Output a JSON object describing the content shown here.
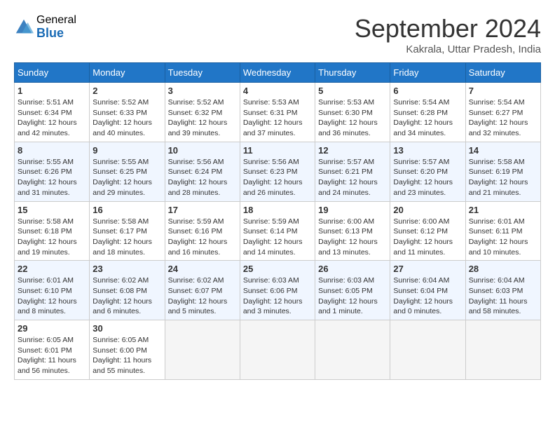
{
  "header": {
    "logo_general": "General",
    "logo_blue": "Blue",
    "month_title": "September 2024",
    "location": "Kakrala, Uttar Pradesh, India"
  },
  "days_of_week": [
    "Sunday",
    "Monday",
    "Tuesday",
    "Wednesday",
    "Thursday",
    "Friday",
    "Saturday"
  ],
  "weeks": [
    [
      {
        "day": "1",
        "info": "Sunrise: 5:51 AM\nSunset: 6:34 PM\nDaylight: 12 hours\nand 42 minutes."
      },
      {
        "day": "2",
        "info": "Sunrise: 5:52 AM\nSunset: 6:33 PM\nDaylight: 12 hours\nand 40 minutes."
      },
      {
        "day": "3",
        "info": "Sunrise: 5:52 AM\nSunset: 6:32 PM\nDaylight: 12 hours\nand 39 minutes."
      },
      {
        "day": "4",
        "info": "Sunrise: 5:53 AM\nSunset: 6:31 PM\nDaylight: 12 hours\nand 37 minutes."
      },
      {
        "day": "5",
        "info": "Sunrise: 5:53 AM\nSunset: 6:30 PM\nDaylight: 12 hours\nand 36 minutes."
      },
      {
        "day": "6",
        "info": "Sunrise: 5:54 AM\nSunset: 6:28 PM\nDaylight: 12 hours\nand 34 minutes."
      },
      {
        "day": "7",
        "info": "Sunrise: 5:54 AM\nSunset: 6:27 PM\nDaylight: 12 hours\nand 32 minutes."
      }
    ],
    [
      {
        "day": "8",
        "info": "Sunrise: 5:55 AM\nSunset: 6:26 PM\nDaylight: 12 hours\nand 31 minutes."
      },
      {
        "day": "9",
        "info": "Sunrise: 5:55 AM\nSunset: 6:25 PM\nDaylight: 12 hours\nand 29 minutes."
      },
      {
        "day": "10",
        "info": "Sunrise: 5:56 AM\nSunset: 6:24 PM\nDaylight: 12 hours\nand 28 minutes."
      },
      {
        "day": "11",
        "info": "Sunrise: 5:56 AM\nSunset: 6:23 PM\nDaylight: 12 hours\nand 26 minutes."
      },
      {
        "day": "12",
        "info": "Sunrise: 5:57 AM\nSunset: 6:21 PM\nDaylight: 12 hours\nand 24 minutes."
      },
      {
        "day": "13",
        "info": "Sunrise: 5:57 AM\nSunset: 6:20 PM\nDaylight: 12 hours\nand 23 minutes."
      },
      {
        "day": "14",
        "info": "Sunrise: 5:58 AM\nSunset: 6:19 PM\nDaylight: 12 hours\nand 21 minutes."
      }
    ],
    [
      {
        "day": "15",
        "info": "Sunrise: 5:58 AM\nSunset: 6:18 PM\nDaylight: 12 hours\nand 19 minutes."
      },
      {
        "day": "16",
        "info": "Sunrise: 5:58 AM\nSunset: 6:17 PM\nDaylight: 12 hours\nand 18 minutes."
      },
      {
        "day": "17",
        "info": "Sunrise: 5:59 AM\nSunset: 6:16 PM\nDaylight: 12 hours\nand 16 minutes."
      },
      {
        "day": "18",
        "info": "Sunrise: 5:59 AM\nSunset: 6:14 PM\nDaylight: 12 hours\nand 14 minutes."
      },
      {
        "day": "19",
        "info": "Sunrise: 6:00 AM\nSunset: 6:13 PM\nDaylight: 12 hours\nand 13 minutes."
      },
      {
        "day": "20",
        "info": "Sunrise: 6:00 AM\nSunset: 6:12 PM\nDaylight: 12 hours\nand 11 minutes."
      },
      {
        "day": "21",
        "info": "Sunrise: 6:01 AM\nSunset: 6:11 PM\nDaylight: 12 hours\nand 10 minutes."
      }
    ],
    [
      {
        "day": "22",
        "info": "Sunrise: 6:01 AM\nSunset: 6:10 PM\nDaylight: 12 hours\nand 8 minutes."
      },
      {
        "day": "23",
        "info": "Sunrise: 6:02 AM\nSunset: 6:08 PM\nDaylight: 12 hours\nand 6 minutes."
      },
      {
        "day": "24",
        "info": "Sunrise: 6:02 AM\nSunset: 6:07 PM\nDaylight: 12 hours\nand 5 minutes."
      },
      {
        "day": "25",
        "info": "Sunrise: 6:03 AM\nSunset: 6:06 PM\nDaylight: 12 hours\nand 3 minutes."
      },
      {
        "day": "26",
        "info": "Sunrise: 6:03 AM\nSunset: 6:05 PM\nDaylight: 12 hours\nand 1 minute."
      },
      {
        "day": "27",
        "info": "Sunrise: 6:04 AM\nSunset: 6:04 PM\nDaylight: 12 hours\nand 0 minutes."
      },
      {
        "day": "28",
        "info": "Sunrise: 6:04 AM\nSunset: 6:03 PM\nDaylight: 11 hours\nand 58 minutes."
      }
    ],
    [
      {
        "day": "29",
        "info": "Sunrise: 6:05 AM\nSunset: 6:01 PM\nDaylight: 11 hours\nand 56 minutes."
      },
      {
        "day": "30",
        "info": "Sunrise: 6:05 AM\nSunset: 6:00 PM\nDaylight: 11 hours\nand 55 minutes."
      },
      {
        "day": "",
        "info": ""
      },
      {
        "day": "",
        "info": ""
      },
      {
        "day": "",
        "info": ""
      },
      {
        "day": "",
        "info": ""
      },
      {
        "day": "",
        "info": ""
      }
    ]
  ]
}
